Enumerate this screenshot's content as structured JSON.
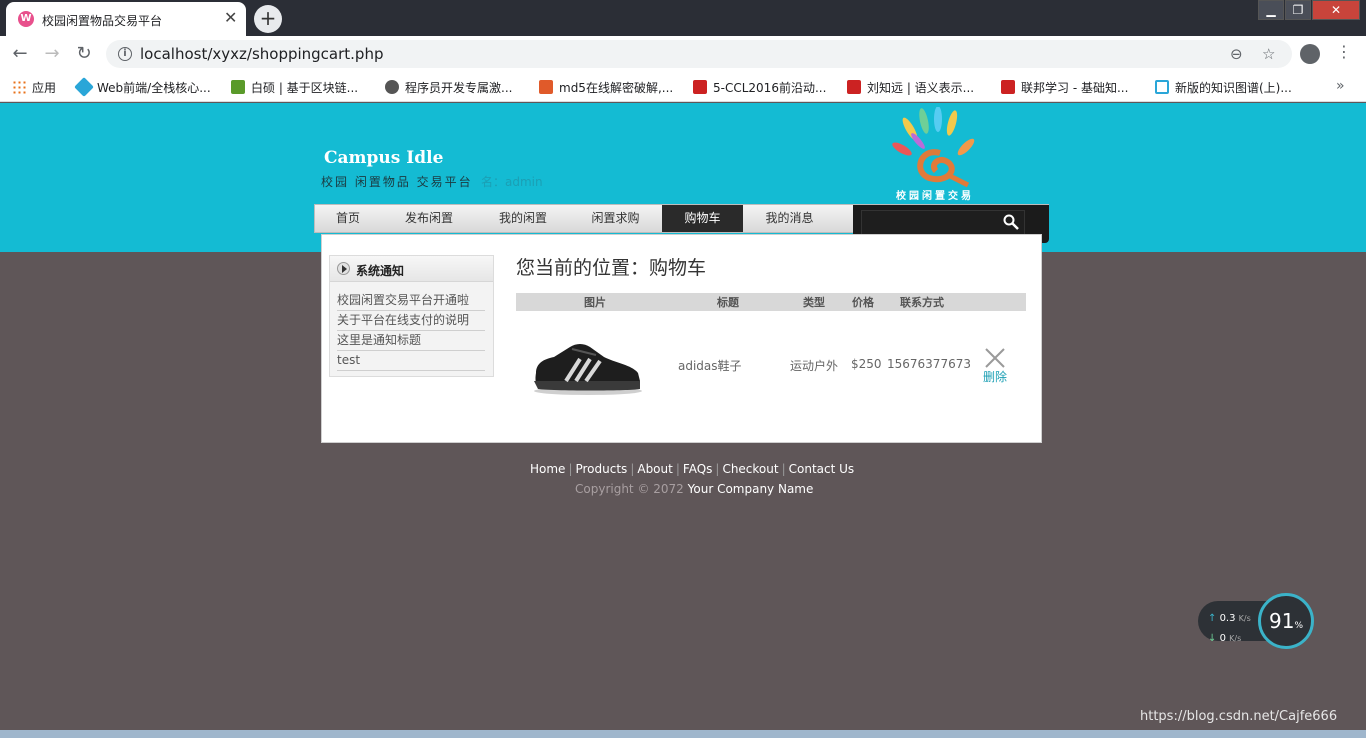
{
  "browser": {
    "tab_title": "校园闲置物品交易平台",
    "tab_close": "✕",
    "new_tab": "+",
    "url": "localhost/xyxz/shoppingcart.php",
    "back": "←",
    "forward": "→",
    "reload": "↻",
    "info": "i",
    "zoom_icon": "⊖",
    "star_icon": "☆",
    "menu": "⋮",
    "min": "▁",
    "max": "❐",
    "close": "✕"
  },
  "bookmarks": [
    {
      "label": "应用",
      "color": "#e8711a"
    },
    {
      "label": "Web前端/全栈核心...",
      "color": "#2aa6d8"
    },
    {
      "label": "白硕 | 基于区块链...",
      "color": "#5a9a2a"
    },
    {
      "label": "程序员开发专属激...",
      "color": "#555555"
    },
    {
      "label": "md5在线解密破解,...",
      "color": "#e05a2a"
    },
    {
      "label": "5-CCL2016前沿动...",
      "color": "#cc2222"
    },
    {
      "label": "刘知远 | 语义表示...",
      "color": "#cc2222"
    },
    {
      "label": "联邦学习 - 基础知...",
      "color": "#cc2222"
    },
    {
      "label": "新版的知识图谱(上)...",
      "color": "#2aa6d8"
    }
  ],
  "bookmarks_more": "»",
  "site": {
    "title": "Campus Idle",
    "subtitle": "校园 闲置物品 交易平台",
    "user_label": "名：admin",
    "logo_text": "校园闲置交易"
  },
  "nav": {
    "items": [
      "首页",
      "发布闲置",
      "我的闲置",
      "闲置求购",
      "购物车",
      "我的消息"
    ],
    "active": "购物车"
  },
  "sidebar": {
    "title": "系统通知",
    "items": [
      "校园闲置交易平台开通啦",
      "关于平台在线支付的说明",
      "这里是通知标题",
      "test"
    ]
  },
  "cart": {
    "location": "您当前的位置：购物车",
    "headers": [
      "图片",
      "标题",
      "类型",
      "价格",
      "联系方式"
    ],
    "row": {
      "title": "adidas鞋子",
      "type": "运动户外",
      "price": "$250",
      "contact": "15676377673",
      "delete": "删除"
    }
  },
  "footer": {
    "links": [
      "Home",
      "Products",
      "About",
      "FAQs",
      "Checkout",
      "Contact Us"
    ],
    "copyright": "Copyright © 2072",
    "company": "Your Company Name"
  },
  "speed_widget": {
    "up": "0.3",
    "down": "0",
    "unit": "K/s",
    "percent": "91",
    "percent_sign": "%"
  },
  "watermark": "https://blog.csdn.net/Cajfe666"
}
